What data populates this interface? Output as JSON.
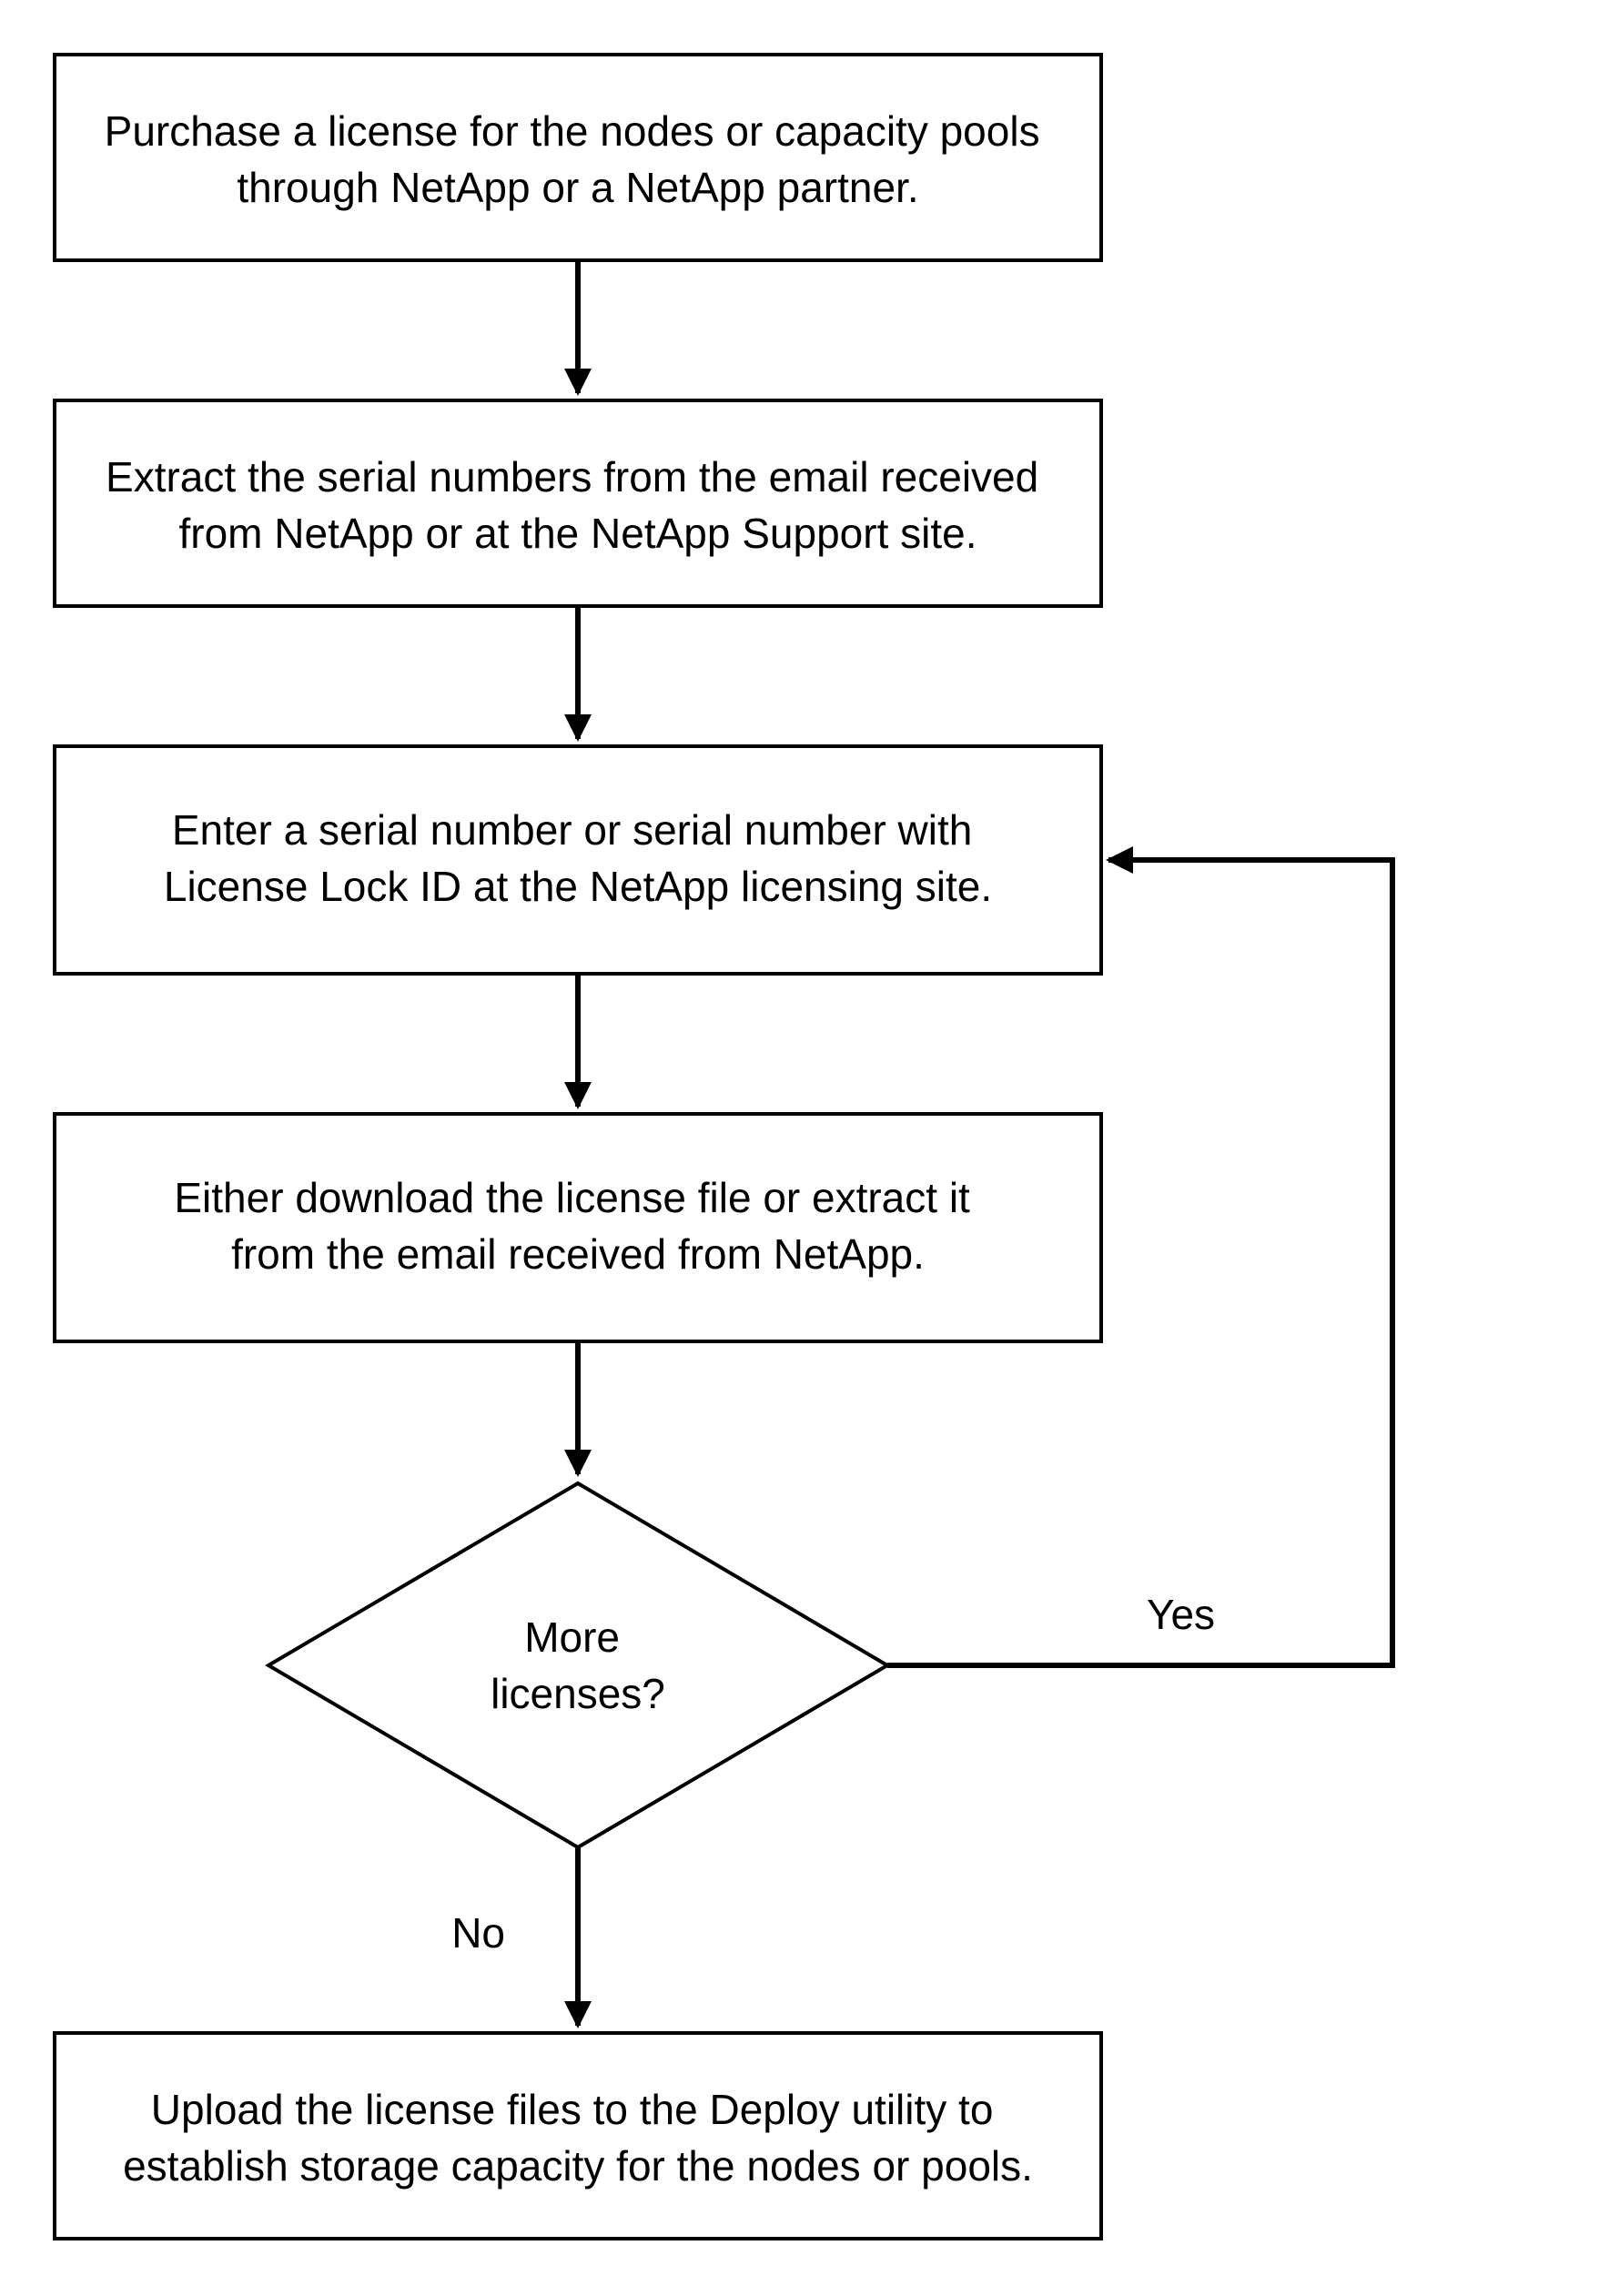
{
  "nodes": {
    "purchase": {
      "line1": "Purchase a license for the nodes or capacity pools",
      "line2": "through NetApp or a NetApp partner."
    },
    "extract": {
      "line1": "Extract the serial numbers from the email received",
      "line2": "from NetApp or at the NetApp Support site."
    },
    "enter": {
      "line1": "Enter a serial number or serial number with",
      "line2": "License Lock ID at the NetApp licensing site."
    },
    "download": {
      "line1": "Either download the license file or extract it",
      "line2": "from the email received from NetApp."
    },
    "decision": {
      "line1": "More",
      "line2": "licenses?"
    },
    "upload": {
      "line1": "Upload the license files to the Deploy utility to",
      "line2": "establish storage capacity for the nodes or pools."
    }
  },
  "labels": {
    "yes": "Yes",
    "no": "No"
  }
}
